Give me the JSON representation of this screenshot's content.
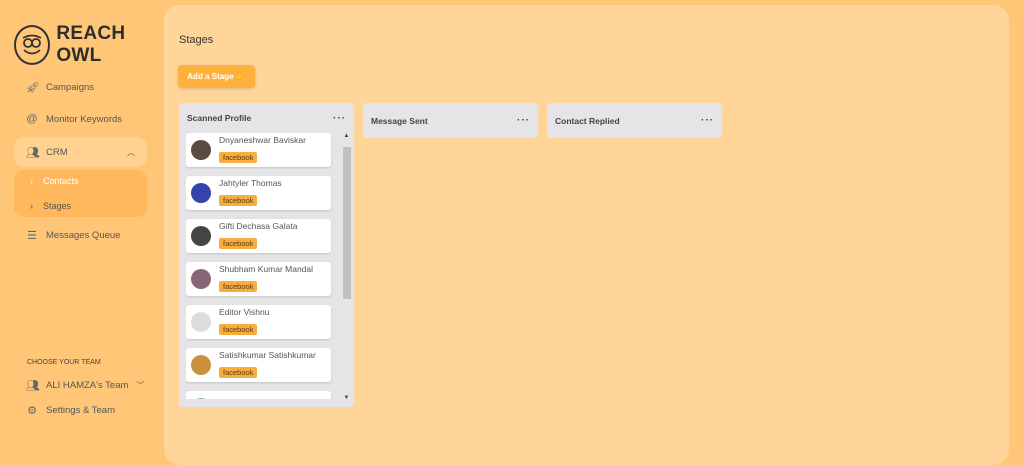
{
  "brand": "REACH OWL",
  "nav": {
    "campaigns": "Campaigns",
    "monitor": "Monitor Keywords",
    "crm": "CRM",
    "contacts": "Contacts",
    "stages": "Stages",
    "queue": "Messages Queue"
  },
  "team": {
    "heading": "CHOOSE YOUR TEAM",
    "name": "ALI HAMZA's Team",
    "settings": "Settings & Team"
  },
  "page": {
    "title": "Stages",
    "add_stage": "Add a Stage 👉"
  },
  "columns": [
    {
      "title": "Scanned Profile",
      "cards": [
        {
          "name": "Dnyaneshwar Baviskar",
          "tag": "facebook",
          "color": "#5a4a42"
        },
        {
          "name": "Jahtyler Thomas",
          "tag": "facebook",
          "color": "#3344aa"
        },
        {
          "name": "Gifti Dechasa Galata",
          "tag": "facebook",
          "color": "#444"
        },
        {
          "name": "Shubham Kumar Mandal",
          "tag": "facebook",
          "color": "#886677"
        },
        {
          "name": "Editor Vishnu",
          "tag": "facebook",
          "color": "#ddd"
        },
        {
          "name": "Satishkumar Satishkumar",
          "tag": "facebook",
          "color": "#c89040"
        }
      ]
    },
    {
      "title": "Message Sent",
      "cards": []
    },
    {
      "title": "Contact Replied",
      "cards": []
    }
  ]
}
